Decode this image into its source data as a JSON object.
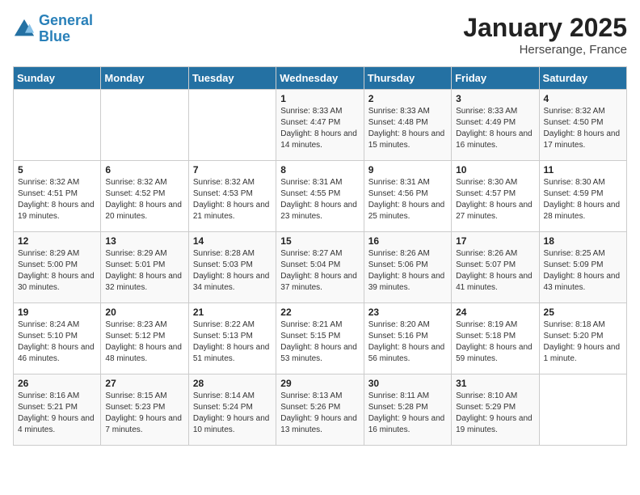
{
  "header": {
    "logo_line1": "General",
    "logo_line2": "Blue",
    "month": "January 2025",
    "location": "Herserange, France"
  },
  "days_of_week": [
    "Sunday",
    "Monday",
    "Tuesday",
    "Wednesday",
    "Thursday",
    "Friday",
    "Saturday"
  ],
  "weeks": [
    [
      {
        "day": "",
        "sunrise": "",
        "sunset": "",
        "daylight": ""
      },
      {
        "day": "",
        "sunrise": "",
        "sunset": "",
        "daylight": ""
      },
      {
        "day": "",
        "sunrise": "",
        "sunset": "",
        "daylight": ""
      },
      {
        "day": "1",
        "sunrise": "Sunrise: 8:33 AM",
        "sunset": "Sunset: 4:47 PM",
        "daylight": "Daylight: 8 hours and 14 minutes."
      },
      {
        "day": "2",
        "sunrise": "Sunrise: 8:33 AM",
        "sunset": "Sunset: 4:48 PM",
        "daylight": "Daylight: 8 hours and 15 minutes."
      },
      {
        "day": "3",
        "sunrise": "Sunrise: 8:33 AM",
        "sunset": "Sunset: 4:49 PM",
        "daylight": "Daylight: 8 hours and 16 minutes."
      },
      {
        "day": "4",
        "sunrise": "Sunrise: 8:32 AM",
        "sunset": "Sunset: 4:50 PM",
        "daylight": "Daylight: 8 hours and 17 minutes."
      }
    ],
    [
      {
        "day": "5",
        "sunrise": "Sunrise: 8:32 AM",
        "sunset": "Sunset: 4:51 PM",
        "daylight": "Daylight: 8 hours and 19 minutes."
      },
      {
        "day": "6",
        "sunrise": "Sunrise: 8:32 AM",
        "sunset": "Sunset: 4:52 PM",
        "daylight": "Daylight: 8 hours and 20 minutes."
      },
      {
        "day": "7",
        "sunrise": "Sunrise: 8:32 AM",
        "sunset": "Sunset: 4:53 PM",
        "daylight": "Daylight: 8 hours and 21 minutes."
      },
      {
        "day": "8",
        "sunrise": "Sunrise: 8:31 AM",
        "sunset": "Sunset: 4:55 PM",
        "daylight": "Daylight: 8 hours and 23 minutes."
      },
      {
        "day": "9",
        "sunrise": "Sunrise: 8:31 AM",
        "sunset": "Sunset: 4:56 PM",
        "daylight": "Daylight: 8 hours and 25 minutes."
      },
      {
        "day": "10",
        "sunrise": "Sunrise: 8:30 AM",
        "sunset": "Sunset: 4:57 PM",
        "daylight": "Daylight: 8 hours and 27 minutes."
      },
      {
        "day": "11",
        "sunrise": "Sunrise: 8:30 AM",
        "sunset": "Sunset: 4:59 PM",
        "daylight": "Daylight: 8 hours and 28 minutes."
      }
    ],
    [
      {
        "day": "12",
        "sunrise": "Sunrise: 8:29 AM",
        "sunset": "Sunset: 5:00 PM",
        "daylight": "Daylight: 8 hours and 30 minutes."
      },
      {
        "day": "13",
        "sunrise": "Sunrise: 8:29 AM",
        "sunset": "Sunset: 5:01 PM",
        "daylight": "Daylight: 8 hours and 32 minutes."
      },
      {
        "day": "14",
        "sunrise": "Sunrise: 8:28 AM",
        "sunset": "Sunset: 5:03 PM",
        "daylight": "Daylight: 8 hours and 34 minutes."
      },
      {
        "day": "15",
        "sunrise": "Sunrise: 8:27 AM",
        "sunset": "Sunset: 5:04 PM",
        "daylight": "Daylight: 8 hours and 37 minutes."
      },
      {
        "day": "16",
        "sunrise": "Sunrise: 8:26 AM",
        "sunset": "Sunset: 5:06 PM",
        "daylight": "Daylight: 8 hours and 39 minutes."
      },
      {
        "day": "17",
        "sunrise": "Sunrise: 8:26 AM",
        "sunset": "Sunset: 5:07 PM",
        "daylight": "Daylight: 8 hours and 41 minutes."
      },
      {
        "day": "18",
        "sunrise": "Sunrise: 8:25 AM",
        "sunset": "Sunset: 5:09 PM",
        "daylight": "Daylight: 8 hours and 43 minutes."
      }
    ],
    [
      {
        "day": "19",
        "sunrise": "Sunrise: 8:24 AM",
        "sunset": "Sunset: 5:10 PM",
        "daylight": "Daylight: 8 hours and 46 minutes."
      },
      {
        "day": "20",
        "sunrise": "Sunrise: 8:23 AM",
        "sunset": "Sunset: 5:12 PM",
        "daylight": "Daylight: 8 hours and 48 minutes."
      },
      {
        "day": "21",
        "sunrise": "Sunrise: 8:22 AM",
        "sunset": "Sunset: 5:13 PM",
        "daylight": "Daylight: 8 hours and 51 minutes."
      },
      {
        "day": "22",
        "sunrise": "Sunrise: 8:21 AM",
        "sunset": "Sunset: 5:15 PM",
        "daylight": "Daylight: 8 hours and 53 minutes."
      },
      {
        "day": "23",
        "sunrise": "Sunrise: 8:20 AM",
        "sunset": "Sunset: 5:16 PM",
        "daylight": "Daylight: 8 hours and 56 minutes."
      },
      {
        "day": "24",
        "sunrise": "Sunrise: 8:19 AM",
        "sunset": "Sunset: 5:18 PM",
        "daylight": "Daylight: 8 hours and 59 minutes."
      },
      {
        "day": "25",
        "sunrise": "Sunrise: 8:18 AM",
        "sunset": "Sunset: 5:20 PM",
        "daylight": "Daylight: 9 hours and 1 minute."
      }
    ],
    [
      {
        "day": "26",
        "sunrise": "Sunrise: 8:16 AM",
        "sunset": "Sunset: 5:21 PM",
        "daylight": "Daylight: 9 hours and 4 minutes."
      },
      {
        "day": "27",
        "sunrise": "Sunrise: 8:15 AM",
        "sunset": "Sunset: 5:23 PM",
        "daylight": "Daylight: 9 hours and 7 minutes."
      },
      {
        "day": "28",
        "sunrise": "Sunrise: 8:14 AM",
        "sunset": "Sunset: 5:24 PM",
        "daylight": "Daylight: 9 hours and 10 minutes."
      },
      {
        "day": "29",
        "sunrise": "Sunrise: 8:13 AM",
        "sunset": "Sunset: 5:26 PM",
        "daylight": "Daylight: 9 hours and 13 minutes."
      },
      {
        "day": "30",
        "sunrise": "Sunrise: 8:11 AM",
        "sunset": "Sunset: 5:28 PM",
        "daylight": "Daylight: 9 hours and 16 minutes."
      },
      {
        "day": "31",
        "sunrise": "Sunrise: 8:10 AM",
        "sunset": "Sunset: 5:29 PM",
        "daylight": "Daylight: 9 hours and 19 minutes."
      },
      {
        "day": "",
        "sunrise": "",
        "sunset": "",
        "daylight": ""
      }
    ]
  ]
}
